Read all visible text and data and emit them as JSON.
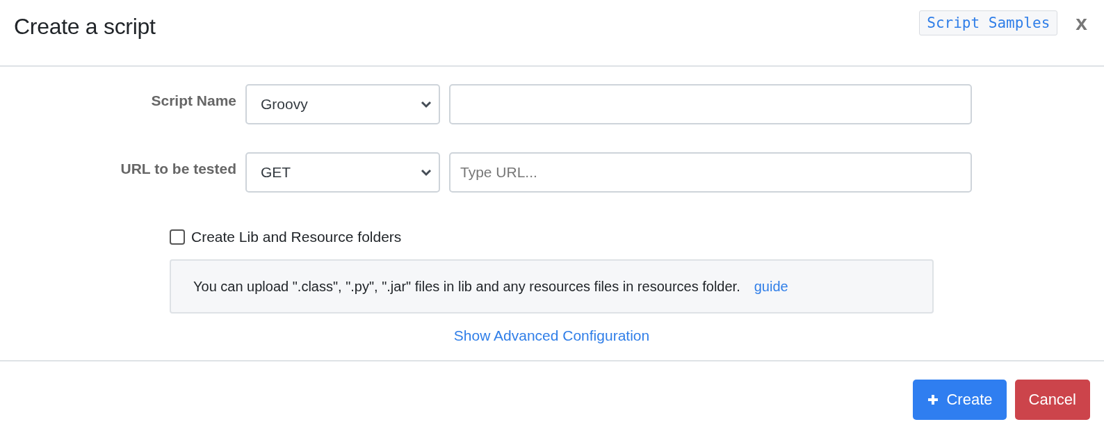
{
  "dialog": {
    "title": "Create a script",
    "samples_button": "Script Samples",
    "close": "x"
  },
  "fields": [
    {
      "label": "Script Name",
      "select": "Groovy"
    },
    {
      "label": "URL to be tested",
      "select": "GET",
      "placeholder": "Type URL..."
    }
  ],
  "checkbox": {
    "label": "Create Lib and Resource folders",
    "checked": false
  },
  "info": {
    "text": "You can upload \".class\", \".py\", \".jar\" files in lib and any resources files in resources folder.",
    "link": "guide"
  },
  "advanced_link": "Show Advanced Configuration",
  "buttons": [
    {
      "label": "Create",
      "kind": "primary",
      "icon": true
    },
    {
      "label": "Cancel",
      "kind": "danger",
      "icon": false
    }
  ]
}
